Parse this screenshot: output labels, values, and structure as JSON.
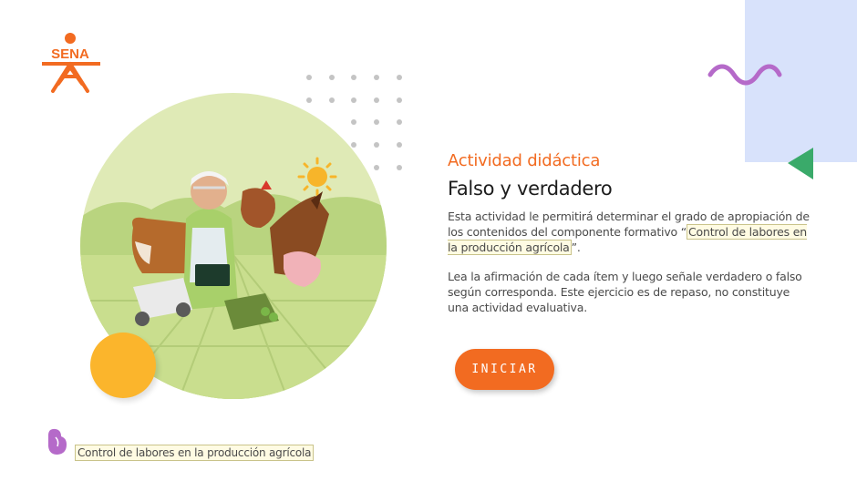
{
  "brand": {
    "logo_text": "SENA",
    "accent_color": "#f26b21"
  },
  "intro": {
    "eyebrow": "Actividad didáctica",
    "title": "Falso y verdadero",
    "paragraph1_before": "Esta actividad le permitirá determinar el grado de apropiación de los contenidos del componente formativo “",
    "paragraph1_highlight": "Control de labores en la producción agrícola",
    "paragraph1_after": "”.",
    "paragraph2": "Lea la afirmación de cada ítem y luego señale verdadero o falso según corresponda.  Este ejercicio es de repaso, no constituye una actividad evaluativa."
  },
  "actions": {
    "start_label": "INICIAR"
  },
  "footer": {
    "course_label": "Control de labores en la producción agrícola"
  },
  "colors": {
    "orange": "#f26b21",
    "yellow": "#fbb52c",
    "light_blue": "#d8e2fb",
    "green": "#3aaa6a",
    "purple": "#b56ac9",
    "field_green": "#c9de8e"
  },
  "icons": [
    "sena-logo",
    "purple-squiggle",
    "green-triangle",
    "dot-grid",
    "farm-illustration",
    "purple-hand-icon"
  ]
}
